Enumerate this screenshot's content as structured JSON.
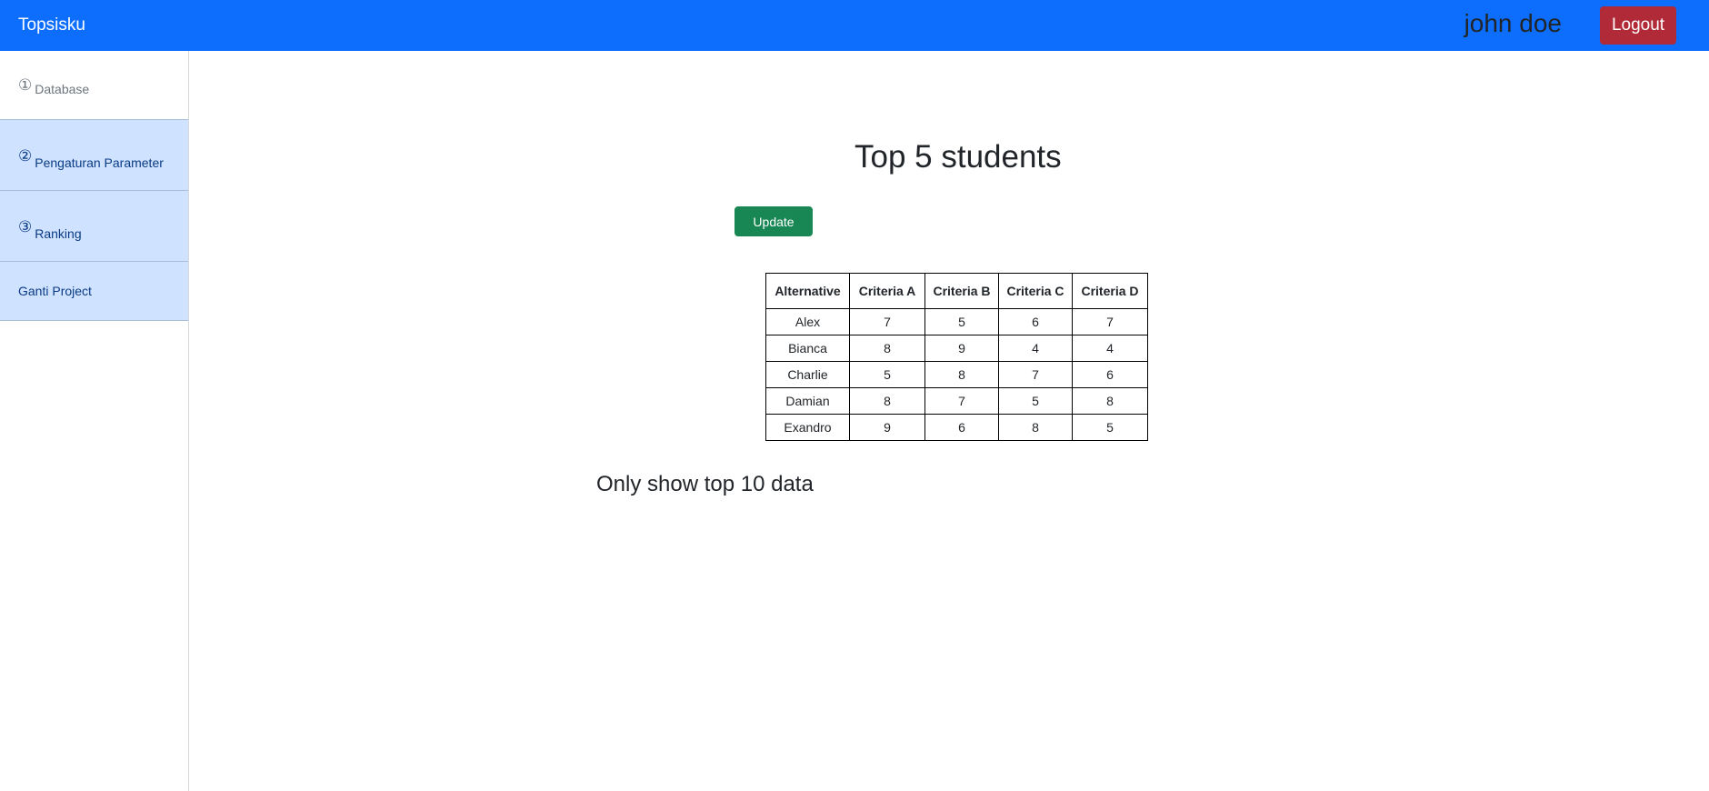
{
  "navbar": {
    "brand": "Topsisku",
    "user_name": "john doe",
    "logout_label": "Logout",
    "bg_color": "#0d6efd"
  },
  "sidebar": {
    "items": [
      {
        "number_icon": "①",
        "label": "Database",
        "state": "inactive"
      },
      {
        "number_icon": "②",
        "label": "Pengaturan Parameter",
        "state": "active"
      },
      {
        "number_icon": "③",
        "label": "Ranking",
        "state": "active"
      },
      {
        "number_icon": "",
        "label": "Ganti Project",
        "state": "active"
      }
    ]
  },
  "main": {
    "title": "Top 5 students",
    "update_label": "Update",
    "table": {
      "headers": [
        "Alternative",
        "Criteria A",
        "Criteria B",
        "Criteria C",
        "Criteria D"
      ],
      "rows": [
        [
          "Alex",
          "7",
          "5",
          "6",
          "7"
        ],
        [
          "Bianca",
          "8",
          "9",
          "4",
          "4"
        ],
        [
          "Charlie",
          "5",
          "8",
          "7",
          "6"
        ],
        [
          "Damian",
          "8",
          "7",
          "5",
          "8"
        ],
        [
          "Exandro",
          "9",
          "6",
          "8",
          "5"
        ]
      ]
    },
    "note": "Only show top 10 data"
  },
  "colors": {
    "logout": "#b02a37",
    "update": "#198754",
    "sidebar_active": "#cfe2ff"
  }
}
